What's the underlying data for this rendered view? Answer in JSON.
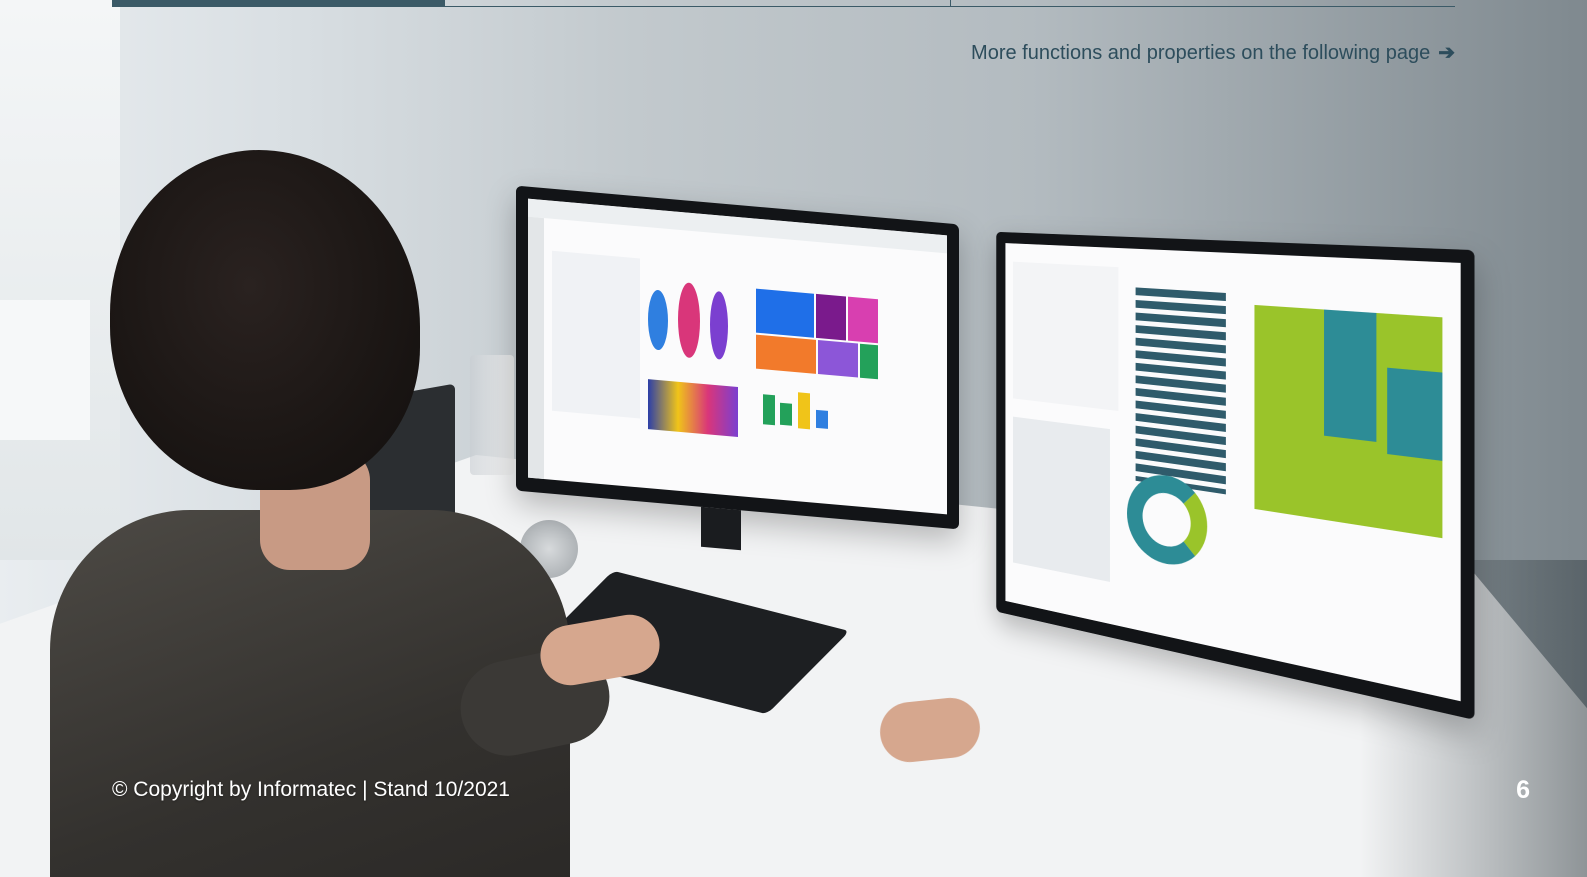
{
  "header": {
    "more_link_text": "More functions and properties on the following page",
    "more_link_arrow": "➔"
  },
  "footer": {
    "copyright": "© Copyright by Informatec | Stand 10/2021",
    "page_number": "6"
  },
  "colors": {
    "accent": "#3b5a67",
    "link_text": "#2d4d5c",
    "footer_text": "#ffffff"
  },
  "image": {
    "icon": "office-photo"
  }
}
